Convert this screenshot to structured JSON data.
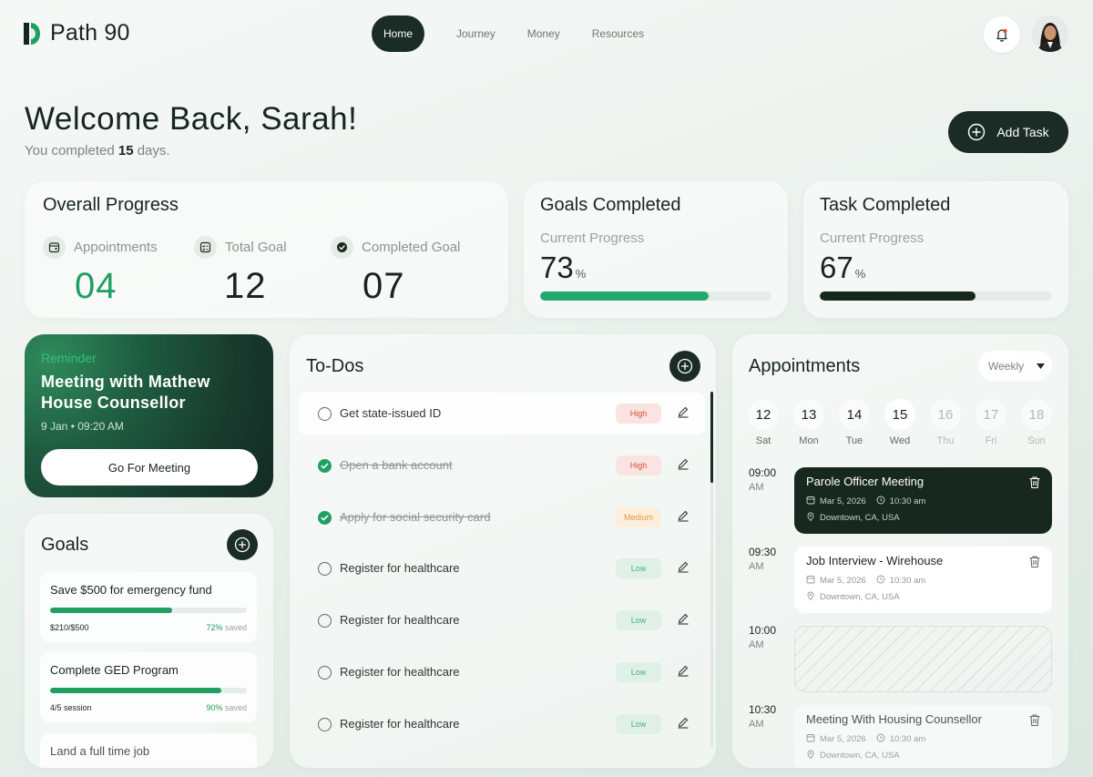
{
  "app": {
    "name": "Path 90"
  },
  "nav": {
    "items": [
      "Home",
      "Journey",
      "Money",
      "Resources"
    ],
    "active": "Home"
  },
  "header": {
    "title": "Welcome Back, Sarah!",
    "sub_prefix": "You completed",
    "sub_days": "15",
    "sub_suffix": "days.",
    "add_task": "Add Task"
  },
  "overall": {
    "title": "Overall Progress",
    "stats": [
      {
        "label": "Appointments",
        "value": "04",
        "icon": "calendar-icon",
        "color": "#1f9f62"
      },
      {
        "label": "Total Goal",
        "value": "12",
        "icon": "checklist-icon",
        "color": "#17241f"
      },
      {
        "label": "Completed Goal",
        "value": "07",
        "icon": "check-circle-icon",
        "color": "#17241f"
      }
    ]
  },
  "goals_completed": {
    "title": "Goals Completed",
    "label": "Current Progress",
    "value": "73",
    "unit": "%",
    "progress": 0.73,
    "color": "#25a86b"
  },
  "tasks_completed": {
    "title": "Task Completed",
    "label": "Current Progress",
    "value": "67",
    "unit": "%",
    "progress": 0.67,
    "color": "#17291f"
  },
  "reminder": {
    "label": "Reminder",
    "title": "Meeting with Mathew House Counsellor",
    "date": "9 Jan • 09:20 AM",
    "button": "Go For Meeting"
  },
  "goals": {
    "title": "Goals",
    "items": [
      {
        "title": "Save $500 for emergency fund",
        "progress_text": "$210/$500",
        "saved_pct": "72%",
        "saved_word": "saved",
        "progress": 0.62
      },
      {
        "title": "Complete GED Program",
        "progress_text": "4/5 session",
        "saved_pct": "90%",
        "saved_word": "saved",
        "progress": 0.87
      },
      {
        "title": "Land a full time job"
      }
    ]
  },
  "todos": {
    "title": "To-Dos",
    "items": [
      {
        "text": "Get state-issued ID",
        "priority": "High",
        "done": false
      },
      {
        "text": "Open a bank account",
        "priority": "High",
        "done": true
      },
      {
        "text": "Apply for social security card",
        "priority": "Medium",
        "done": true
      },
      {
        "text": "Register for healthcare",
        "priority": "Low",
        "done": false
      },
      {
        "text": "Register for healthcare",
        "priority": "Low",
        "done": false
      },
      {
        "text": "Register for healthcare",
        "priority": "Low",
        "done": false
      },
      {
        "text": "Register for healthcare",
        "priority": "Low",
        "done": false
      }
    ]
  },
  "appointments": {
    "title": "Appointments",
    "filter": "Weekly",
    "days": [
      {
        "num": "12",
        "name": "Sat",
        "state": "normal"
      },
      {
        "num": "13",
        "name": "Mon",
        "state": "normal"
      },
      {
        "num": "14",
        "name": "Tue",
        "state": "normal"
      },
      {
        "num": "15",
        "name": "Wed",
        "state": "selected"
      },
      {
        "num": "16",
        "name": "Thu",
        "state": "faded"
      },
      {
        "num": "17",
        "name": "Fri",
        "state": "faded"
      },
      {
        "num": "18",
        "name": "Sun",
        "state": "faded"
      }
    ],
    "times": [
      {
        "time": "09:00",
        "ampm": "AM"
      },
      {
        "time": "09:30",
        "ampm": "AM"
      },
      {
        "time": "10:00",
        "ampm": "AM"
      },
      {
        "time": "10:30",
        "ampm": "AM"
      }
    ],
    "items": [
      {
        "title": "Parole Officer Meeting",
        "date": "Mar 5, 2026",
        "time": "10:30 am",
        "location": "Downtown, CA, USA",
        "style": "dark"
      },
      {
        "title": "Job Interview - Wirehouse",
        "date": "Mar 5, 2026",
        "time": "10:30 am",
        "location": "Downtown, CA, USA",
        "style": "white"
      },
      {
        "title": "Meeting With Housing Counsellor",
        "date": "Mar 5, 2026",
        "time": "10:30 am",
        "location": "Downtown, CA, USA",
        "style": "pale"
      }
    ]
  }
}
